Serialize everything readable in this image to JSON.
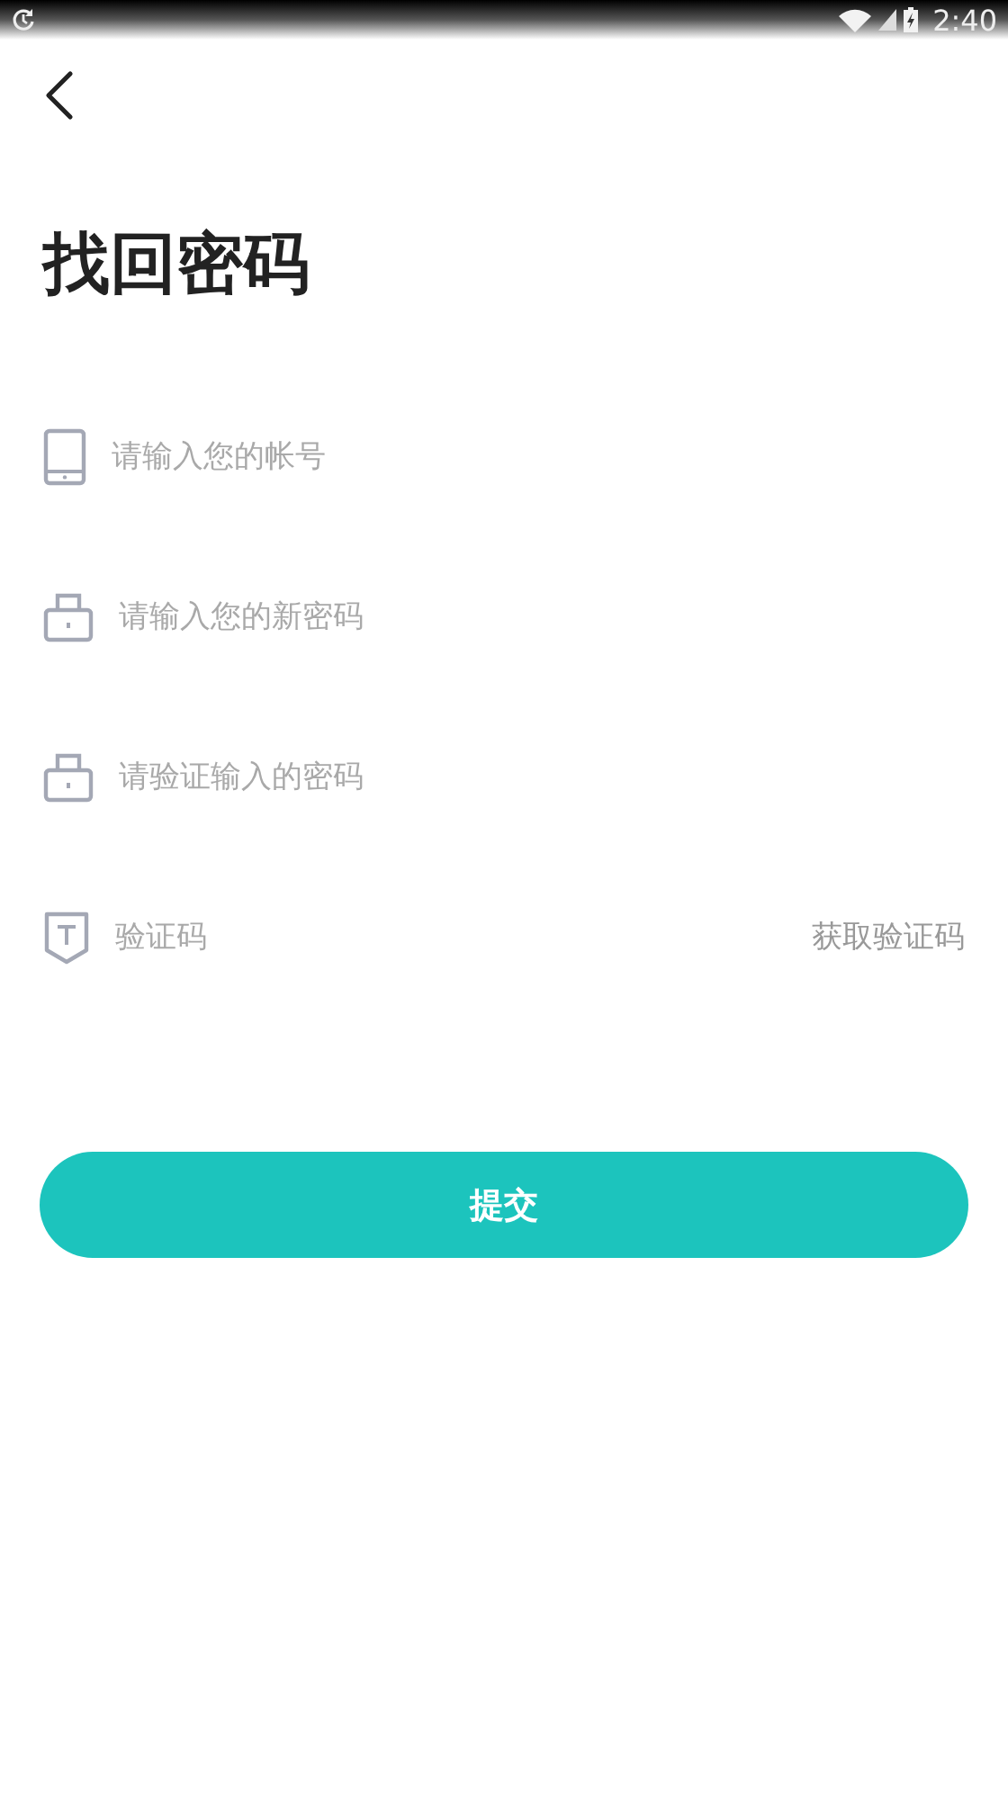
{
  "status_bar": {
    "time": "2:40"
  },
  "title": "找回密码",
  "fields": [
    {
      "kind": "phone",
      "placeholder": "请输入您的帐号"
    },
    {
      "kind": "lock",
      "placeholder": "请输入您的新密码"
    },
    {
      "kind": "lock",
      "placeholder": "请验证输入的密码"
    },
    {
      "kind": "shield",
      "placeholder": "验证码",
      "action": "获取验证码"
    }
  ],
  "submit": "提交"
}
